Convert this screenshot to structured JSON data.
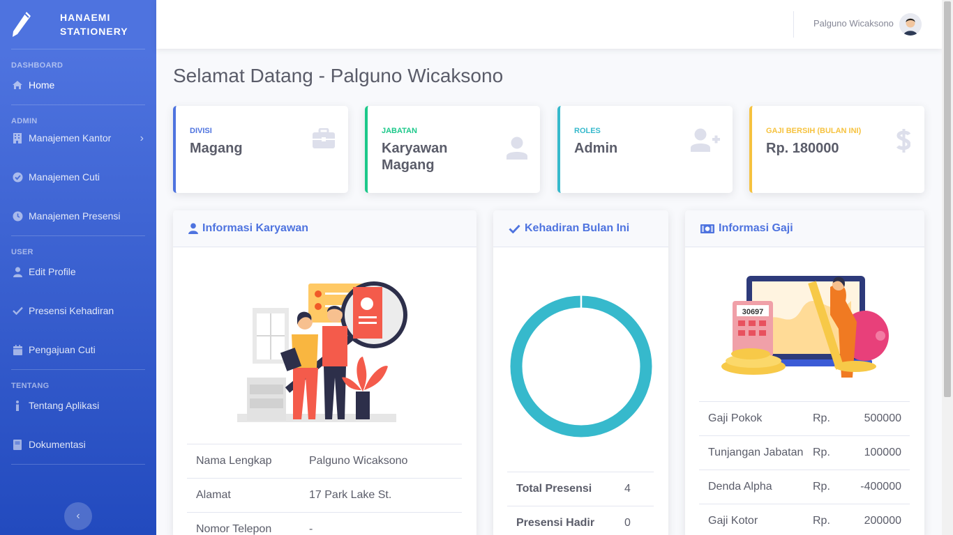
{
  "brand": {
    "line1": "HANAEMI",
    "line2": "STATIONERY"
  },
  "sidebar": {
    "headings": [
      "DASHBOARD",
      "ADMIN",
      "USER",
      "TENTANG"
    ],
    "items": [
      {
        "label": "Home",
        "icon": "home-icon"
      },
      {
        "label": "Manajemen Kantor",
        "icon": "building-icon"
      },
      {
        "label": "Manajemen Cuti",
        "icon": "check-circle-icon"
      },
      {
        "label": "Manajemen Presensi",
        "icon": "clock-icon"
      },
      {
        "label": "Edit Profile",
        "icon": "user-icon"
      },
      {
        "label": "Presensi Kehadiran",
        "icon": "check-icon"
      },
      {
        "label": "Pengajuan Cuti",
        "icon": "calendar-icon"
      },
      {
        "label": "Tentang Aplikasi",
        "icon": "info-icon"
      },
      {
        "label": "Dokumentasi",
        "icon": "book-icon"
      }
    ]
  },
  "topbar": {
    "user_name": "Palguno Wicaksono"
  },
  "page": {
    "title": "Selamat Datang - Palguno Wicaksono"
  },
  "stats": [
    {
      "label": "DIVISI",
      "value": "Magang",
      "color": "#4e73df",
      "icon": "briefcase-icon"
    },
    {
      "label": "JABATAN",
      "value": "Karyawan Magang",
      "color": "#1cc88a",
      "icon": "user-icon"
    },
    {
      "label": "ROLES",
      "value": "Admin",
      "color": "#36b9cc",
      "icon": "user-plus-icon"
    },
    {
      "label": "GAJI BERSIH (BULAN INI)",
      "value": "Rp. 180000",
      "color": "#f6c23e",
      "icon": "dollar-icon"
    }
  ],
  "karyawan": {
    "title": "Informasi Karyawan",
    "rows": [
      {
        "label": "Nama Lengkap",
        "value": "Palguno Wicaksono"
      },
      {
        "label": "Alamat",
        "value": "17 Park Lake St."
      },
      {
        "label": "Nomor Telepon",
        "value": "-"
      }
    ]
  },
  "kehadiran": {
    "title": "Kehadiran Bulan Ini",
    "rows": [
      {
        "label": "Total Presensi",
        "value": "4"
      },
      {
        "label": "Presensi Hadir",
        "value": "0"
      }
    ],
    "donut_fraction": 1.0,
    "color": "#36b9cc"
  },
  "gaji": {
    "title": "Informasi Gaji",
    "illustration_number": "30697",
    "rows": [
      {
        "label": "Gaji Pokok",
        "currency": "Rp.",
        "value": "500000"
      },
      {
        "label": "Tunjangan Jabatan",
        "currency": "Rp.",
        "value": "100000"
      },
      {
        "label": "Denda Alpha",
        "currency": "Rp.",
        "value": "-400000"
      },
      {
        "label": "Gaji Kotor",
        "currency": "Rp.",
        "value": "200000"
      }
    ]
  }
}
